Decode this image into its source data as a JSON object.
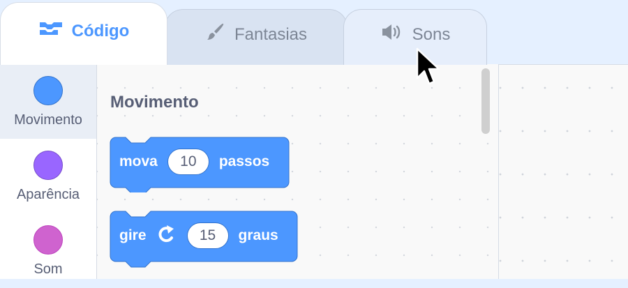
{
  "tabs": [
    {
      "label": "Código",
      "icon": "code-icon",
      "active": true
    },
    {
      "label": "Fantasias",
      "icon": "paintbrush-icon",
      "active": false
    },
    {
      "label": "Sons",
      "icon": "speaker-icon",
      "active": false
    }
  ],
  "categories": [
    {
      "label": "Movimento",
      "color": "#4c97ff",
      "selected": true
    },
    {
      "label": "Aparência",
      "color": "#9966ff",
      "selected": false
    },
    {
      "label": "Som",
      "color": "#cf63cf",
      "selected": false
    }
  ],
  "flyout": {
    "section_title": "Movimento",
    "blocks": [
      {
        "prefix": "mova",
        "value": "10",
        "suffix": "passos"
      },
      {
        "prefix": "gire",
        "icon": "rotate-right-icon",
        "value": "15",
        "suffix": "graus"
      }
    ]
  },
  "colors": {
    "motion_block": "#4c97ff",
    "motion_block_border": "#3373cc",
    "accent": "#4c97ff"
  }
}
